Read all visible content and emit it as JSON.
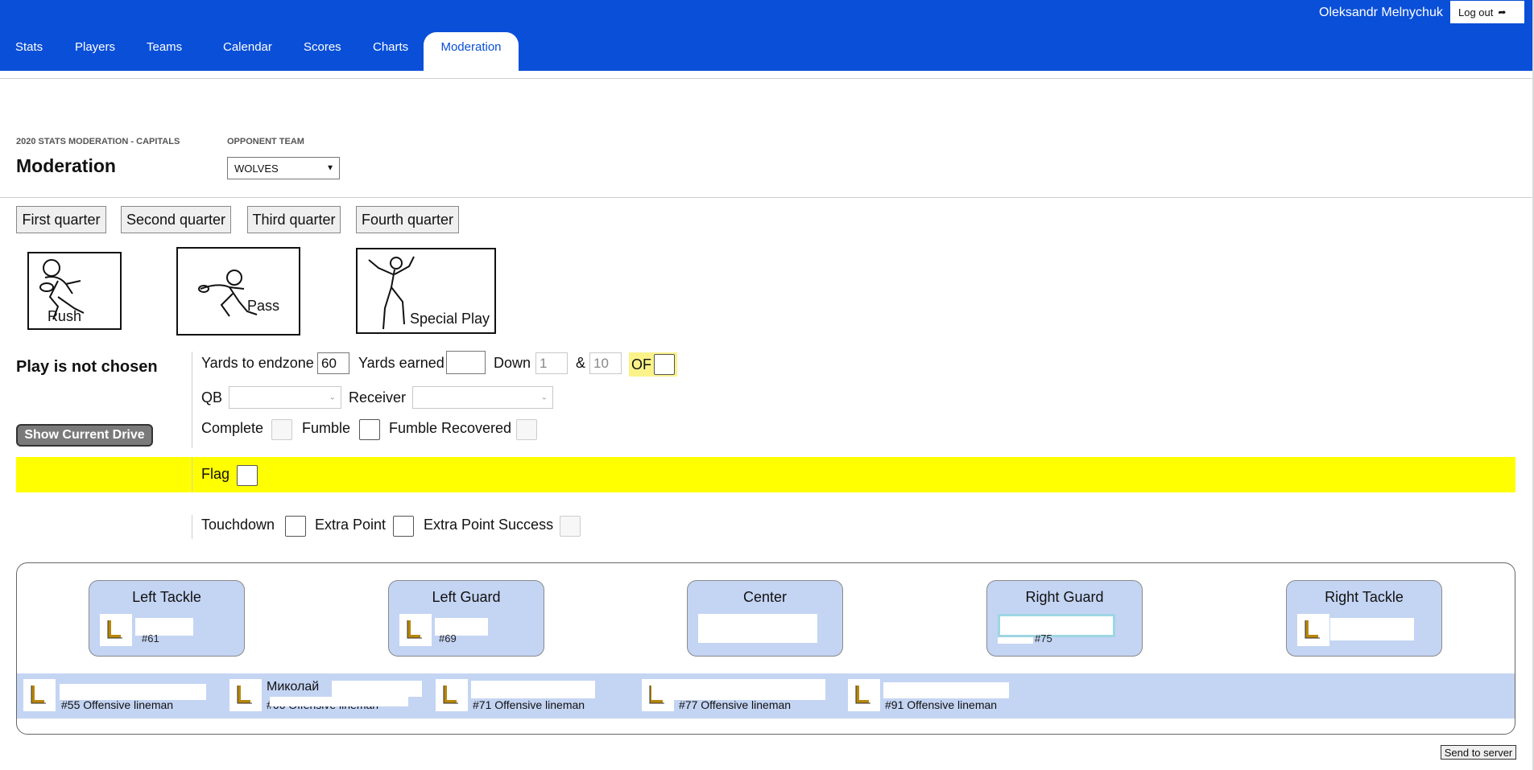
{
  "header": {
    "user_name": "Oleksandr Melnychuk",
    "logout_label": "Log out",
    "logout_icon": "logout-arrow-icon",
    "brand_color": "#0a4fd8",
    "nav": [
      {
        "label": "Stats"
      },
      {
        "label": "Players"
      },
      {
        "label": "Teams"
      },
      {
        "label": "Calendar"
      },
      {
        "label": "Scores"
      },
      {
        "label": "Charts"
      },
      {
        "label": "Moderation",
        "active": true
      }
    ]
  },
  "page": {
    "section_label": "2020 STATS MODERATION - CAPITALS",
    "title": "Moderation",
    "opponent_label": "OPPONENT TEAM",
    "opponent_value": "WOLVES"
  },
  "quarters": [
    "First quarter",
    "Second quarter",
    "Third quarter",
    "Fourth quarter"
  ],
  "plays": {
    "rush": "Rush",
    "pass": "Pass",
    "special": "Special Play"
  },
  "form": {
    "status": "Play is not chosen",
    "show_drive": "Show Current Drive",
    "yards_to_endzone_label": "Yards to endzone",
    "yards_to_endzone_value": "60",
    "yards_earned_label": "Yards earned",
    "yards_earned_value": "",
    "down_label": "Down",
    "down_value": "1",
    "amp": "&",
    "distance_value": "10",
    "of_label": "OF",
    "qb_label": "QB",
    "receiver_label": "Receiver",
    "complete_label": "Complete",
    "fumble_label": "Fumble",
    "fumble_recovered_label": "Fumble Recovered",
    "flag_label": "Flag",
    "flag_color": "#ffff00",
    "touchdown_label": "Touchdown",
    "extra_point_label": "Extra Point",
    "extra_point_success_label": "Extra Point Success"
  },
  "line": {
    "positions": [
      {
        "title": "Left Tackle",
        "number": "#61"
      },
      {
        "title": "Left Guard",
        "number": "#69"
      },
      {
        "title": "Center",
        "number": ""
      },
      {
        "title": "Right Guard",
        "number": "#75"
      },
      {
        "title": "Right Tackle",
        "number": ""
      }
    ],
    "bench": [
      {
        "name": "",
        "desc": "#55 Offensive lineman"
      },
      {
        "name": "Миколай",
        "desc": "#66 Offensive lineman"
      },
      {
        "name": "",
        "desc": "#71 Offensive lineman"
      },
      {
        "name": "",
        "desc": "#77 Offensive lineman"
      },
      {
        "name": "",
        "desc": "#91 Offensive lineman"
      }
    ]
  },
  "send_label": "Send to server"
}
